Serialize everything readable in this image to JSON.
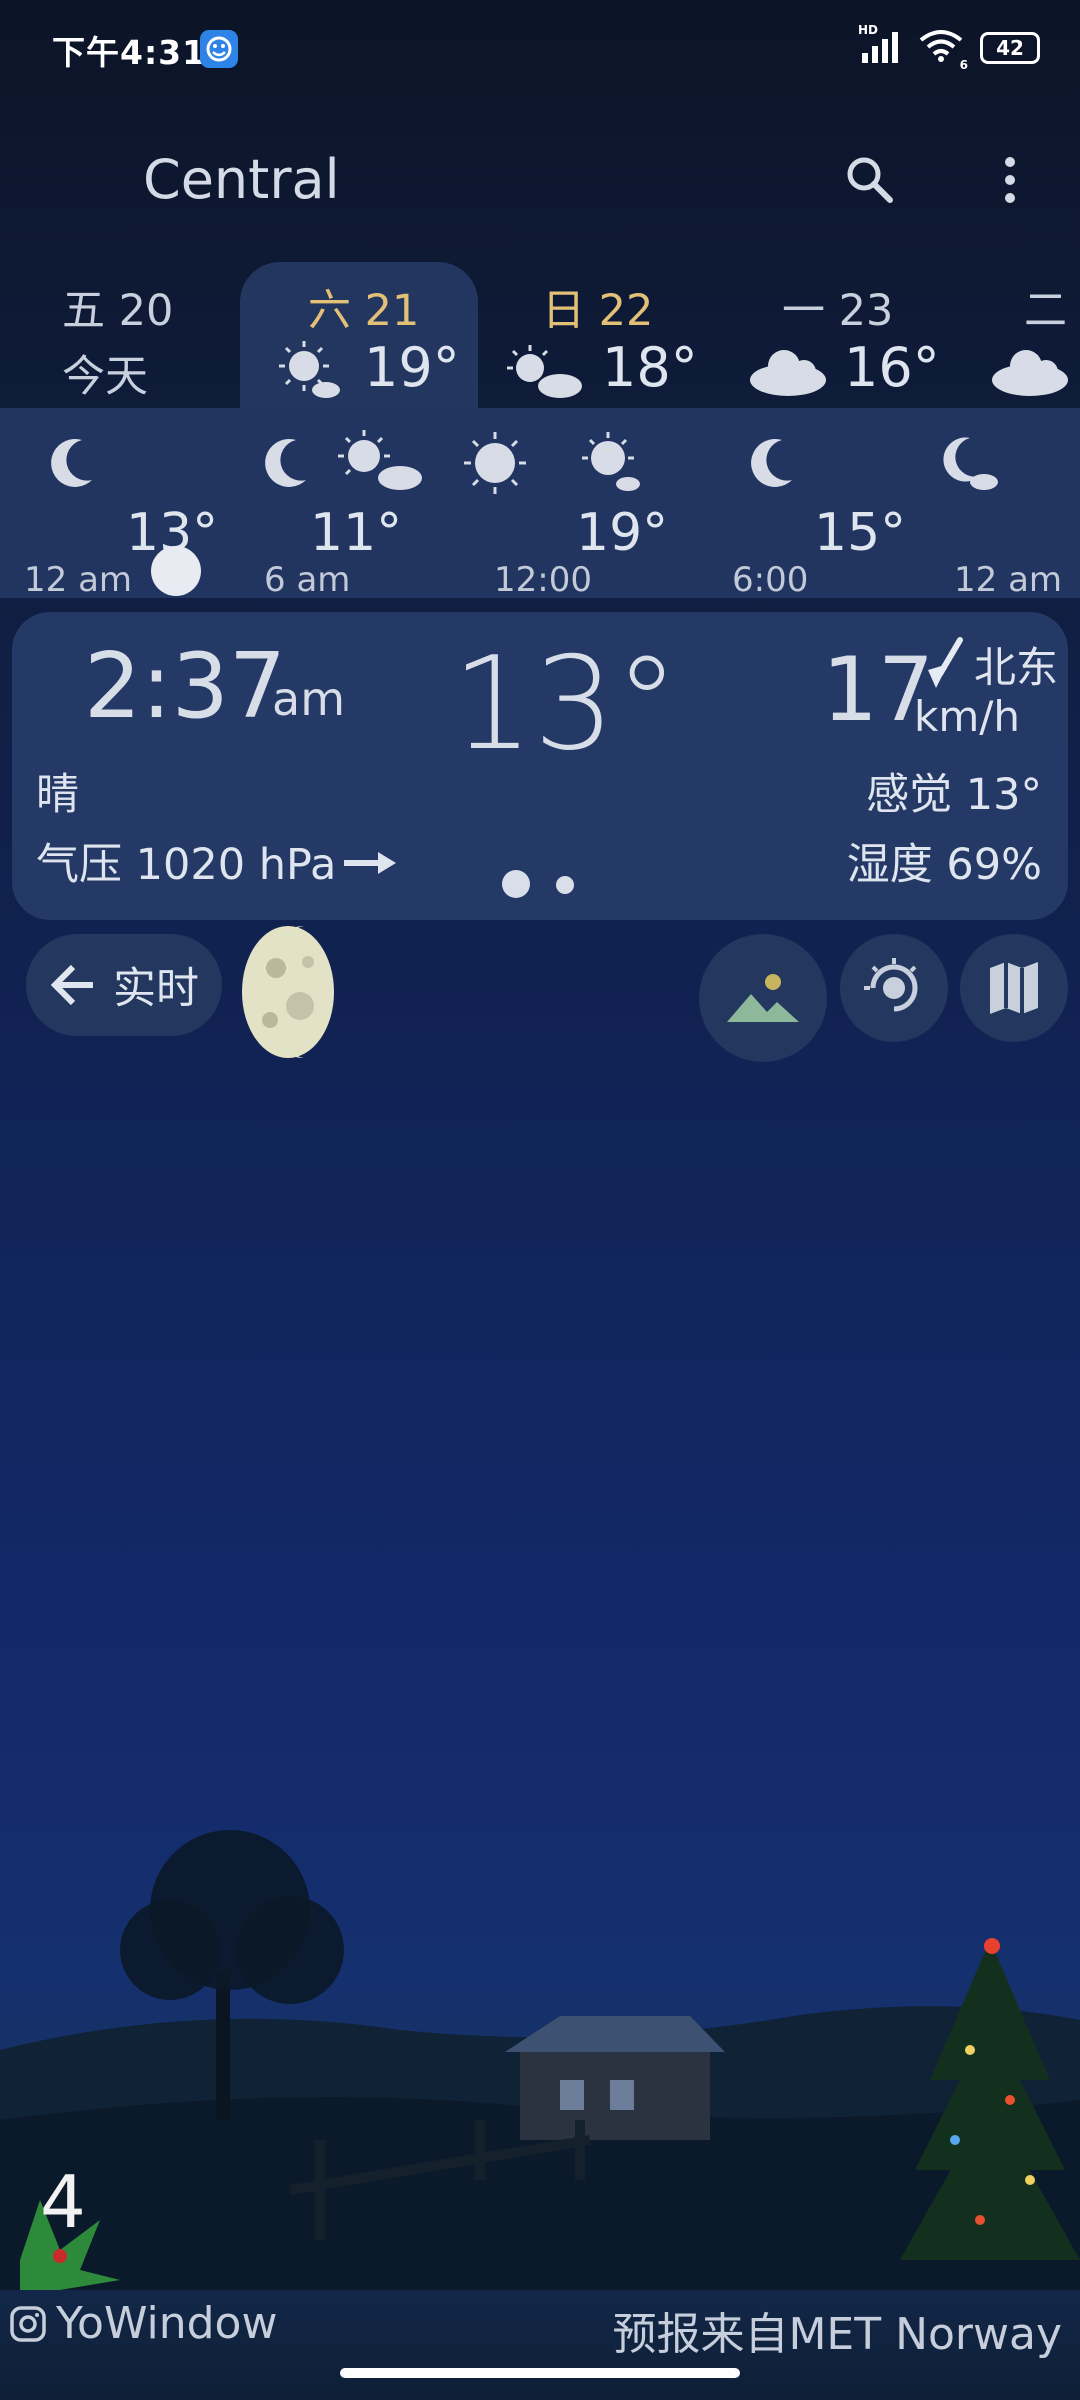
{
  "status_bar": {
    "time": "下午4:31",
    "signal_label": "HD",
    "wifi_label": "6",
    "battery": "42"
  },
  "header": {
    "city": "Central",
    "search_icon": "search-icon",
    "menu_icon": "more-vertical-icon"
  },
  "days": [
    {
      "label": "五 20",
      "sublabel": "今天",
      "temp": "",
      "selected": false
    },
    {
      "label": "六 21",
      "sublabel": "",
      "temp": "19°",
      "selected": true,
      "icon": "sun-cloud-icon"
    },
    {
      "label": "日 22",
      "sublabel": "",
      "temp": "18°",
      "selected": false,
      "icon": "sun-cloud-icon"
    },
    {
      "label": "一 23",
      "sublabel": "",
      "temp": "16°",
      "selected": false,
      "icon": "cloud-icon"
    },
    {
      "label": "二",
      "sublabel": "",
      "temp": "",
      "selected": false,
      "icon": "cloud-icon"
    }
  ],
  "hourly": {
    "temps": [
      "13°",
      "11°",
      "19°",
      "15°"
    ],
    "times": [
      "12 am",
      "6 am",
      "12:00",
      "6:00",
      "12 am"
    ]
  },
  "current": {
    "time": "2:37",
    "ampm": "am",
    "temp": "13°",
    "wind_speed": "17",
    "wind_dir": "北东",
    "wind_unit": "km/h",
    "condition": "晴",
    "feels_like": "感觉 13°",
    "pressure": "气压 1020 hPa",
    "humidity": "湿度 69%"
  },
  "controls": {
    "realtime": "实时"
  },
  "footer": {
    "brand": "YoWindow",
    "source": "预报来自MET Norway",
    "badge": "4"
  },
  "colors": {
    "accent_selected_day": "#e2c177",
    "card_bg": "#253967",
    "sky_top": "#0c1427",
    "sky_bottom": "#15306f"
  }
}
